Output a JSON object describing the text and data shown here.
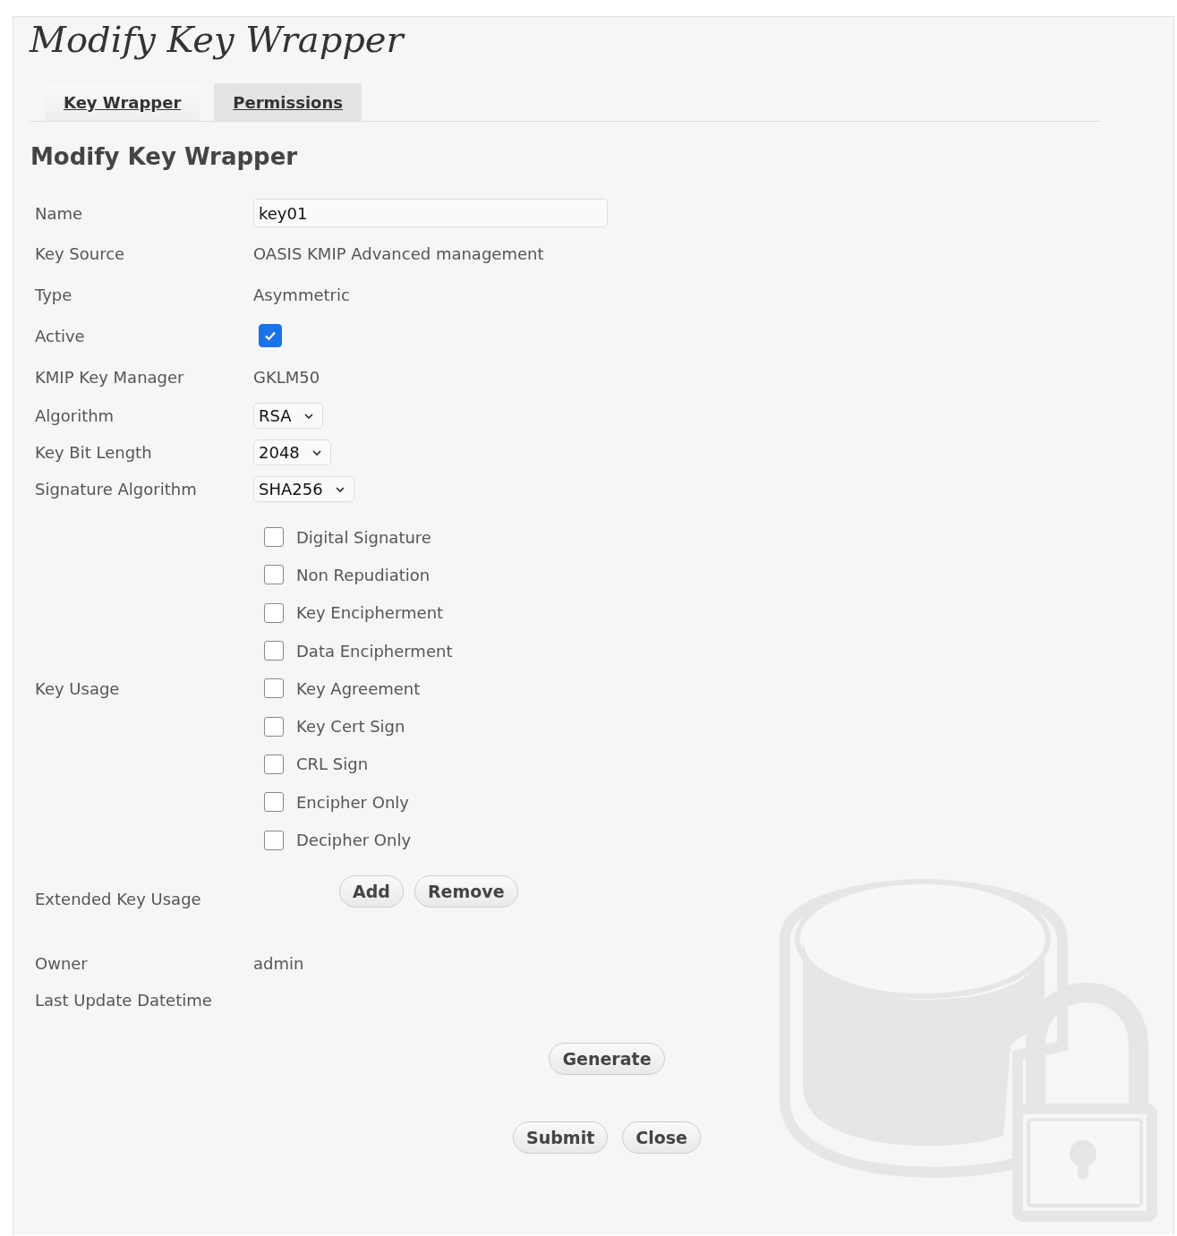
{
  "title": "Modify Key Wrapper",
  "tabs": [
    {
      "label": "Key Wrapper",
      "selected": true
    },
    {
      "label": "Permissions",
      "selected": false
    }
  ],
  "heading": "Modify Key Wrapper",
  "fields": [
    {
      "label": "Name",
      "kind": "input",
      "value": "key01"
    },
    {
      "label": "Key Source",
      "kind": "text",
      "value": "OASIS KMIP Advanced management"
    },
    {
      "label": "Type",
      "kind": "text",
      "value": "Asymmetric"
    },
    {
      "label": "Active",
      "kind": "checkbox",
      "checked": true
    },
    {
      "label": "KMIP Key Manager",
      "kind": "text",
      "value": "GKLM50"
    },
    {
      "label": "Algorithm",
      "kind": "select",
      "value": "RSA"
    },
    {
      "label": "Key Bit Length",
      "kind": "select",
      "value": "2048"
    },
    {
      "label": "Signature Algorithm",
      "kind": "select",
      "value": "SHA256"
    }
  ],
  "key_usage": {
    "label": "Key Usage",
    "options": [
      {
        "label": "Digital Signature",
        "checked": false
      },
      {
        "label": "Non Repudiation",
        "checked": false
      },
      {
        "label": "Key Encipherment",
        "checked": false
      },
      {
        "label": "Data Encipherment",
        "checked": false
      },
      {
        "label": "Key Agreement",
        "checked": false
      },
      {
        "label": "Key Cert Sign",
        "checked": false
      },
      {
        "label": "CRL Sign",
        "checked": false
      },
      {
        "label": "Encipher Only",
        "checked": false
      },
      {
        "label": "Decipher Only",
        "checked": false
      }
    ]
  },
  "extended_key_usage": {
    "label": "Extended Key Usage",
    "buttons": [
      "Add",
      "Remove"
    ]
  },
  "info_fields": [
    {
      "label": "Owner",
      "value": "admin"
    },
    {
      "label": "Last Update Datetime"
    }
  ],
  "generate_button": "Generate",
  "footer_buttons": [
    "Submit",
    "Close"
  ]
}
